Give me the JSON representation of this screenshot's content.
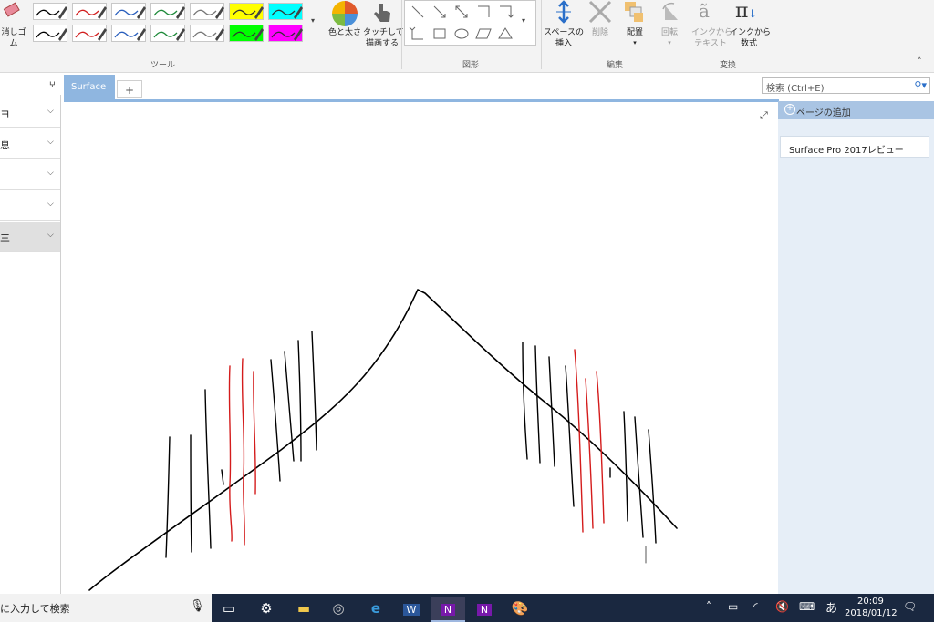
{
  "ribbon": {
    "eraser_label": "消しゴ\nム",
    "groups": {
      "tools": "ツール",
      "shapes": "図形",
      "edit": "編集",
      "convert": "変換"
    },
    "color_thickness": "色と太さ",
    "touch_draw_line1": "タッチして",
    "touch_draw_line2": "描画する",
    "insert_space_line1": "スペースの",
    "insert_space_line2": "挿入",
    "delete": "削除",
    "arrange": "配置",
    "rotate": "回転",
    "ink_to_text_line1": "インクから",
    "ink_to_text_line2": "テキスト",
    "ink_to_math_line1": "インクから",
    "ink_to_math_line2": "数式",
    "pens": [
      {
        "color": "#000000"
      },
      {
        "color": "#d22020"
      },
      {
        "color": "#2a5fbd"
      },
      {
        "color": "#1e8a3a"
      },
      {
        "color": "#777777"
      },
      {
        "color": "#ffff00"
      },
      {
        "color": "#00ffff"
      },
      {
        "color": "#000000"
      },
      {
        "color": "#d22020"
      },
      {
        "color": "#2a5fbd"
      },
      {
        "color": "#1e8a3a"
      },
      {
        "color": "#777777"
      },
      {
        "color": "#00ff00"
      },
      {
        "color": "#ff00ff"
      }
    ]
  },
  "tabs": {
    "active": "Surface",
    "add": "+"
  },
  "search": {
    "placeholder": "検索 (Ctrl+E)"
  },
  "left_panel": {
    "sections": [
      {
        "text": "ヨ"
      },
      {
        "text": "息"
      },
      {
        "text": ""
      },
      {
        "text": ""
      },
      {
        "text": "三"
      }
    ]
  },
  "right_panel": {
    "add_page": "ページの追加",
    "pages": [
      "Surface Pro 2017レビュー"
    ]
  },
  "taskbar": {
    "search_text": "に入力して検索",
    "time": "20:09",
    "date": "2018/01/12",
    "ime": "あ"
  }
}
